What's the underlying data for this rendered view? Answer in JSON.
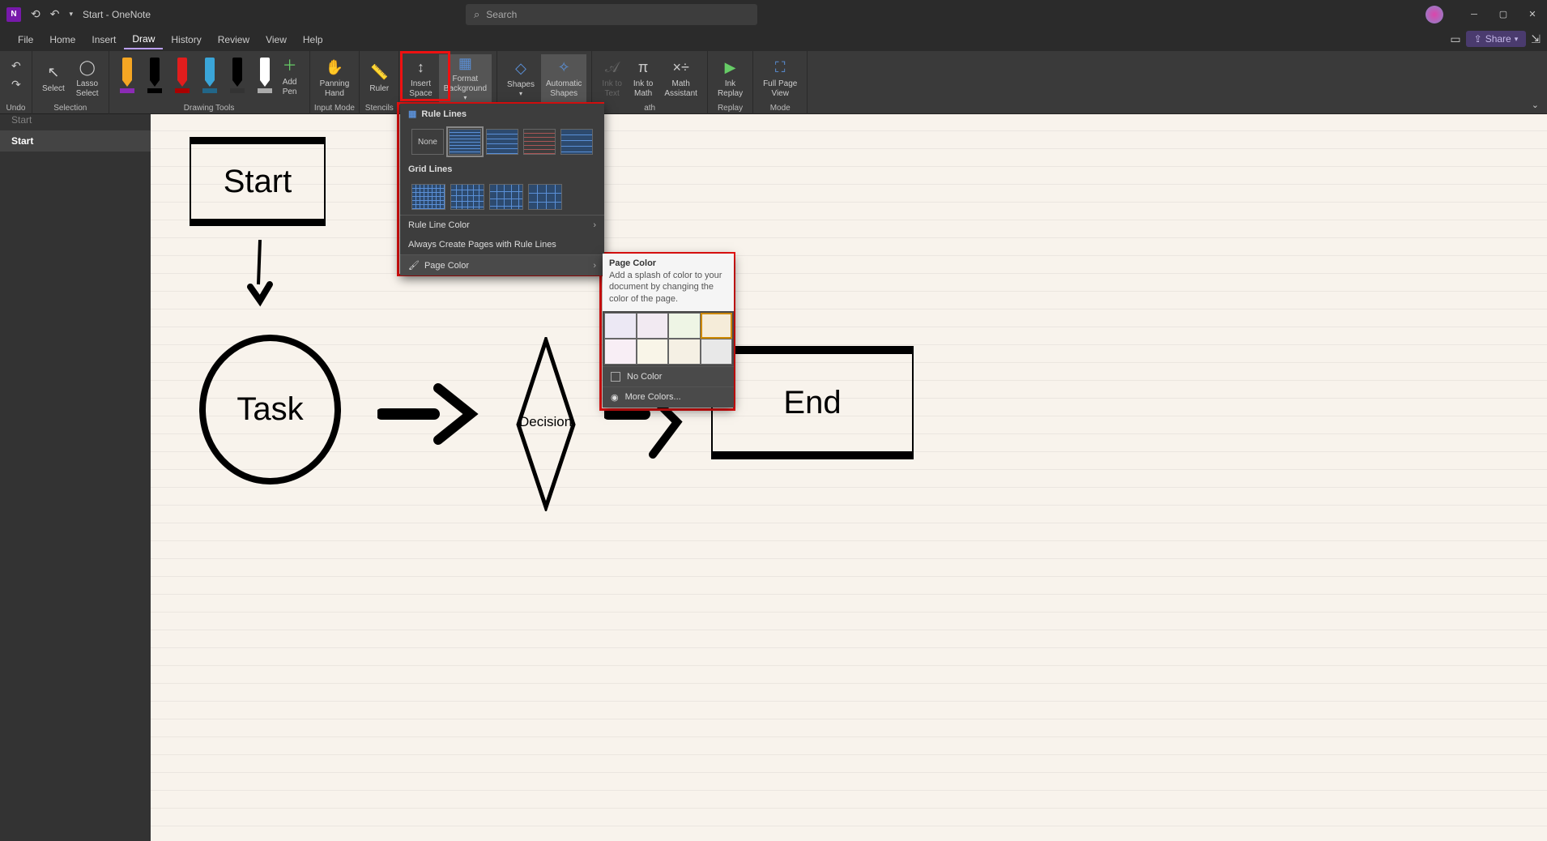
{
  "title_bar": {
    "doc_name": "Start - OneNote",
    "search_placeholder": "Search"
  },
  "menu": {
    "tabs": [
      "File",
      "Home",
      "Insert",
      "Draw",
      "History",
      "Review",
      "View",
      "Help"
    ],
    "active_index": 3,
    "share_label": "Share"
  },
  "ribbon": {
    "undo_group": "Undo",
    "selection_group": "Selection",
    "drawing_group": "Drawing Tools",
    "input_group": "Input Mode",
    "stencils_group": "Stencils",
    "replay_group": "Replay",
    "mode_group": "Mode",
    "ath_group": "ath",
    "select": "Select",
    "lasso": "Lasso\nSelect",
    "add_pen": "Add\nPen",
    "panning": "Panning\nHand",
    "ruler": "Ruler",
    "insert_space": "Insert\nSpace",
    "format_bg": "Format\nBackground",
    "shapes": "Shapes",
    "auto_shapes": "Automatic\nShapes",
    "ink_text": "Ink to\nText",
    "ink_math": "Ink to\nMath",
    "math_assist": "Math\nAssistant",
    "ink_replay": "Ink\nReplay",
    "full_page": "Full Page\nView"
  },
  "dropdown": {
    "rule_lines_header": "Rule Lines",
    "none_label": "None",
    "grid_lines_header": "Grid Lines",
    "rule_line_color": "Rule Line Color",
    "always_create": "Always Create Pages with Rule Lines",
    "page_color": "Page Color"
  },
  "page_color": {
    "title": "Page Color",
    "desc": "Add a splash of color to your document by changing the color of the page.",
    "no_color": "No Color",
    "more_colors": "More Colors...",
    "colors_row1": [
      "#ece8f4",
      "#f2eaf2",
      "#eef5e5",
      "#f5ecd9"
    ],
    "colors_row2": [
      "#f8eef5",
      "#f9f5e8",
      "#f5f0e4",
      "#e8e8e8"
    ]
  },
  "sidebar": {
    "items": [
      "Start",
      "Start"
    ],
    "active_index": 1
  },
  "flowchart": {
    "start": "Start",
    "task": "Task",
    "decision": "Decision",
    "end": "End"
  },
  "pens": [
    {
      "body": "#f5a623",
      "base": "#8b2bb5"
    },
    {
      "body": "#000000",
      "base": "#000"
    },
    {
      "body": "#e11d1d",
      "base": "#a00"
    },
    {
      "body": "#3aa5d8",
      "base": "#268"
    },
    {
      "body": "#000000",
      "base": "#333"
    },
    {
      "body": "#ffffff",
      "base": "#aaa"
    }
  ]
}
